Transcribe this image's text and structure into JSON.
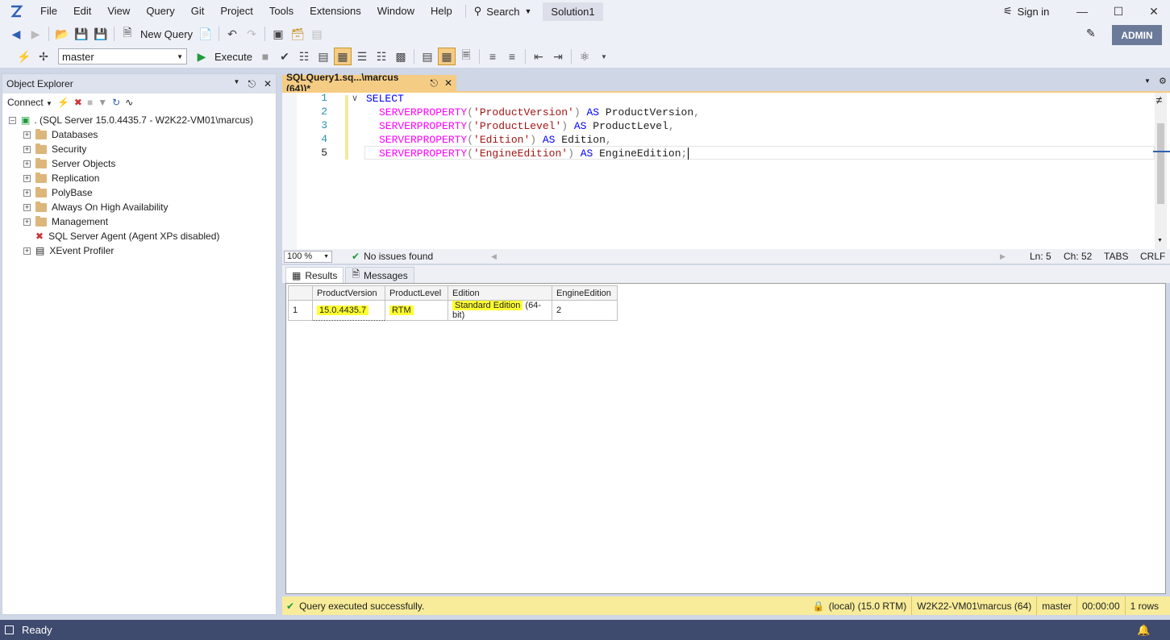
{
  "menubar": {
    "items": [
      "File",
      "Edit",
      "View",
      "Query",
      "Git",
      "Project",
      "Tools",
      "Extensions",
      "Window",
      "Help"
    ],
    "search_label": "Search",
    "solution": "Solution1",
    "signin": "Sign in"
  },
  "toolbar": {
    "new_query": "New Query",
    "database": "master",
    "execute": "Execute",
    "admin_badge": "ADMIN"
  },
  "object_explorer": {
    "title": "Object Explorer",
    "connect": "Connect",
    "server": ". (SQL Server 15.0.4435.7 - W2K22-VM01\\marcus)",
    "nodes": [
      "Databases",
      "Security",
      "Server Objects",
      "Replication",
      "PolyBase",
      "Always On High Availability",
      "Management"
    ],
    "agent": "SQL Server Agent (Agent XPs disabled)",
    "xevent": "XEvent Profiler"
  },
  "editor": {
    "tab_title": "SQLQuery1.sq...\\marcus (64))*",
    "line_numbers": [
      "1",
      "2",
      "3",
      "4",
      "5"
    ],
    "lines": [
      {
        "kw": "SELECT"
      },
      {
        "fn": "SERVERPROPERTY",
        "open": "(",
        "str": "'ProductVersion'",
        "close": ")",
        "as": "AS",
        "alias": "ProductVersion",
        "end": ","
      },
      {
        "fn": "SERVERPROPERTY",
        "open": "(",
        "str": "'ProductLevel'",
        "close": ")",
        "as": "AS",
        "alias": "ProductLevel",
        "end": ","
      },
      {
        "fn": "SERVERPROPERTY",
        "open": "(",
        "str": "'Edition'",
        "close": ")",
        "as": "AS",
        "alias": "Edition",
        "end": ","
      },
      {
        "fn": "SERVERPROPERTY",
        "open": "(",
        "str": "'EngineEdition'",
        "close": ")",
        "as": "AS",
        "alias": "EngineEdition",
        "end": ";"
      }
    ],
    "zoom": "100 %",
    "issues": "No issues found",
    "ln": "Ln: 5",
    "ch": "Ch: 52",
    "tabs": "TABS",
    "eol": "CRLF"
  },
  "results": {
    "tabs": [
      "Results",
      "Messages"
    ],
    "columns": [
      "ProductVersion",
      "ProductLevel",
      "Edition",
      "EngineEdition"
    ],
    "rows": [
      {
        "num": "1",
        "ProductVersion": "15.0.4435.7",
        "ProductLevel": "RTM",
        "EditionHighlighted": "Standard Edition",
        "EditionRest": " (64-bit)",
        "EngineEdition": "2"
      }
    ]
  },
  "query_status": {
    "message": "Query executed successfully.",
    "server": "(local) (15.0 RTM)",
    "user": "W2K22-VM01\\marcus (64)",
    "database": "master",
    "time": "00:00:00",
    "rows": "1 rows"
  },
  "app_status": {
    "text": "Ready"
  },
  "colors": {
    "keyword": "#0000ff",
    "function": "#ff00ff",
    "string": "#a31515",
    "highlight": "#ffff33",
    "tab_active": "#f5cc84",
    "status_bar": "#3e4a6e"
  }
}
